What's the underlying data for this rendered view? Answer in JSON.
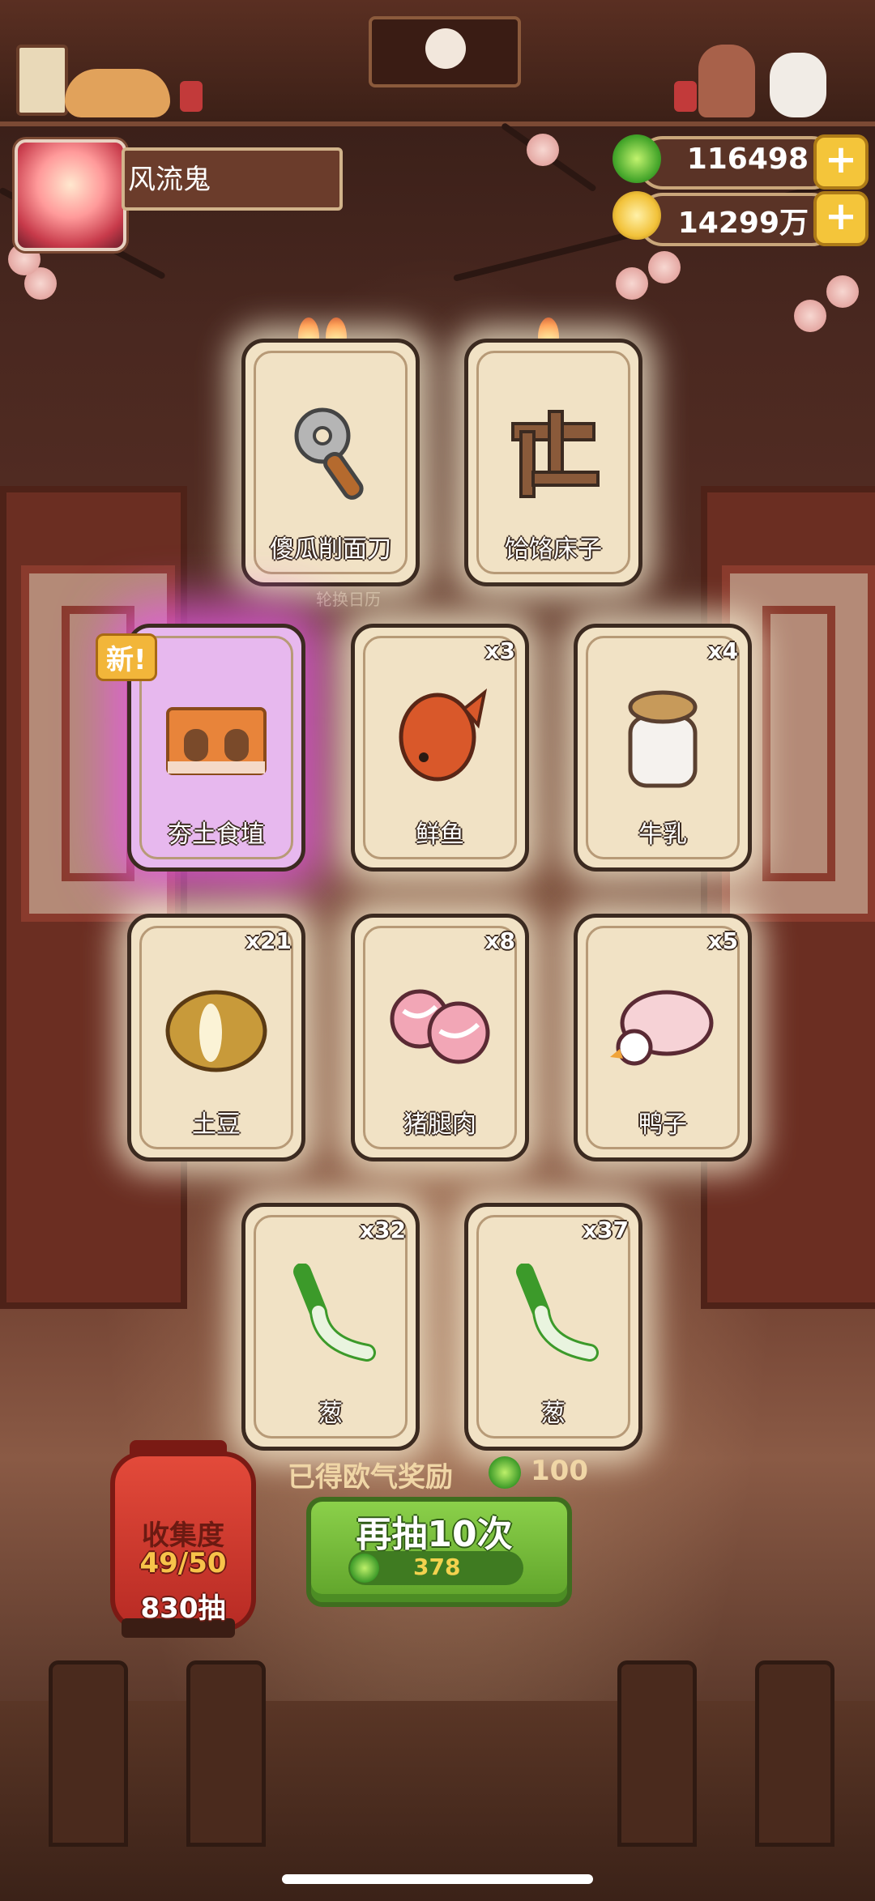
{
  "player": {
    "name": "风流鬼"
  },
  "currency": {
    "jade": {
      "value": "116498",
      "icon": "jade-coin-icon"
    },
    "gold": {
      "value": "14299万",
      "icon": "gold-coin-icon"
    },
    "add_symbol": "+"
  },
  "board": {
    "rotate_label": "轮换日历",
    "new_badge": "新!"
  },
  "cards": [
    {
      "label": "傻瓜削面刀",
      "count": "",
      "icon": "noodle-knife-icon"
    },
    {
      "label": "饸饹床子",
      "count": "",
      "icon": "noodle-press-icon"
    },
    {
      "label": "夯土食埴",
      "count": "",
      "icon": "earthen-wall-icon"
    },
    {
      "label": "鲜鱼",
      "count": "x3",
      "icon": "fish-icon"
    },
    {
      "label": "牛乳",
      "count": "x4",
      "icon": "milk-jar-icon"
    },
    {
      "label": "土豆",
      "count": "x21",
      "icon": "potato-icon"
    },
    {
      "label": "猪腿肉",
      "count": "x8",
      "icon": "pork-icon"
    },
    {
      "label": "鸭子",
      "count": "x5",
      "icon": "duck-icon"
    },
    {
      "label": "葱",
      "count": "x32",
      "icon": "scallion-icon"
    },
    {
      "label": "葱",
      "count": "x37",
      "icon": "scallion-icon"
    }
  ],
  "reward": {
    "text": "已得欧气奖励",
    "value": "100"
  },
  "draw_button": {
    "label": "再抽10次",
    "cost": "378"
  },
  "collection": {
    "title": "收集度",
    "progress": "49/50",
    "draws": "830抽"
  },
  "colors": {
    "accent_green": "#6fb833",
    "gold": "#f4c53a",
    "card_bg": "#f1e2c5"
  }
}
